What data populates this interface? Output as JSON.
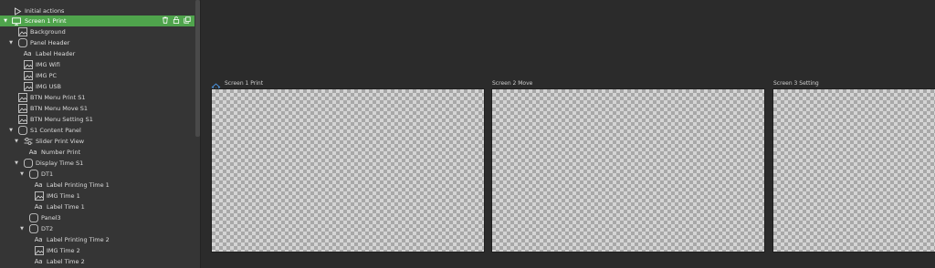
{
  "tree": {
    "initial_actions": "Initial actions",
    "selected": "Screen 1 Print",
    "items": [
      {
        "label": "Background"
      },
      {
        "label": "Panel Header"
      },
      {
        "label": "Label Header"
      },
      {
        "label": "IMG Wifi"
      },
      {
        "label": "IMG PC"
      },
      {
        "label": "IMG USB"
      },
      {
        "label": "BTN Menu Print S1"
      },
      {
        "label": "BTN Menu Move S1"
      },
      {
        "label": "BTN Menu Setting S1"
      },
      {
        "label": "S1 Content Panel"
      },
      {
        "label": "Slider Print View"
      },
      {
        "label": "Number Print"
      },
      {
        "label": "Display Time S1"
      },
      {
        "label": "DT1"
      },
      {
        "label": "Label Printing Time 1"
      },
      {
        "label": "IMG Time 1"
      },
      {
        "label": "Label Time 1"
      },
      {
        "label": "Panel3"
      },
      {
        "label": "DT2"
      },
      {
        "label": "Label Printing Time 2"
      },
      {
        "label": "IMG Time 2"
      },
      {
        "label": "Label Time 2"
      }
    ],
    "icon_text": "Aa"
  },
  "screens": [
    {
      "title": "Screen 1 Print"
    },
    {
      "title": "Screen 2 Move"
    },
    {
      "title": "Screen 3 Setting"
    }
  ],
  "colors": {
    "selected_row": "#4fa44c",
    "home_icon": "#4a90d9",
    "panel_bg": "#353535",
    "canvas_bg": "#2b2b2b"
  }
}
